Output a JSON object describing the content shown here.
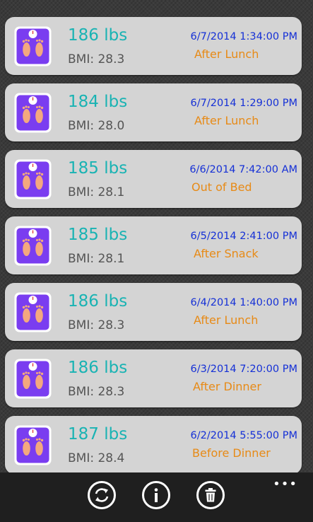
{
  "entries": [
    {
      "weight": "186 lbs",
      "bmi": "BMI:  28.3",
      "datetime": "6/7/2014 1:34:00 PM",
      "meal": "After Lunch"
    },
    {
      "weight": "184 lbs",
      "bmi": "BMI:  28.0",
      "datetime": "6/7/2014 1:29:00 PM",
      "meal": "After Lunch"
    },
    {
      "weight": "185 lbs",
      "bmi": "BMI:  28.1",
      "datetime": "6/6/2014 7:42:00 AM",
      "meal": "Out of Bed"
    },
    {
      "weight": "185 lbs",
      "bmi": "BMI:  28.1",
      "datetime": "6/5/2014 2:41:00 PM",
      "meal": "After Snack"
    },
    {
      "weight": "186 lbs",
      "bmi": "BMI:  28.3",
      "datetime": "6/4/2014 1:40:00 PM",
      "meal": "After Lunch"
    },
    {
      "weight": "186 lbs",
      "bmi": "BMI:  28.3",
      "datetime": "6/3/2014 7:20:00 PM",
      "meal": "After Dinner"
    },
    {
      "weight": "187 lbs",
      "bmi": "BMI:  28.4",
      "datetime": "6/2/2014 5:55:00 PM",
      "meal": "Before Dinner"
    }
  ],
  "appbar": {
    "buttons": [
      {
        "icon": "sync-icon"
      },
      {
        "icon": "info-icon"
      },
      {
        "icon": "trash-icon"
      }
    ],
    "more_label": "•••"
  },
  "colors": {
    "weight": "#19b3b3",
    "bmi": "#555555",
    "datetime": "#1530d6",
    "meal": "#e78a16",
    "card": "#d4d4d4",
    "scale_body": "#7a3df0",
    "feet": "#f4a87f"
  }
}
